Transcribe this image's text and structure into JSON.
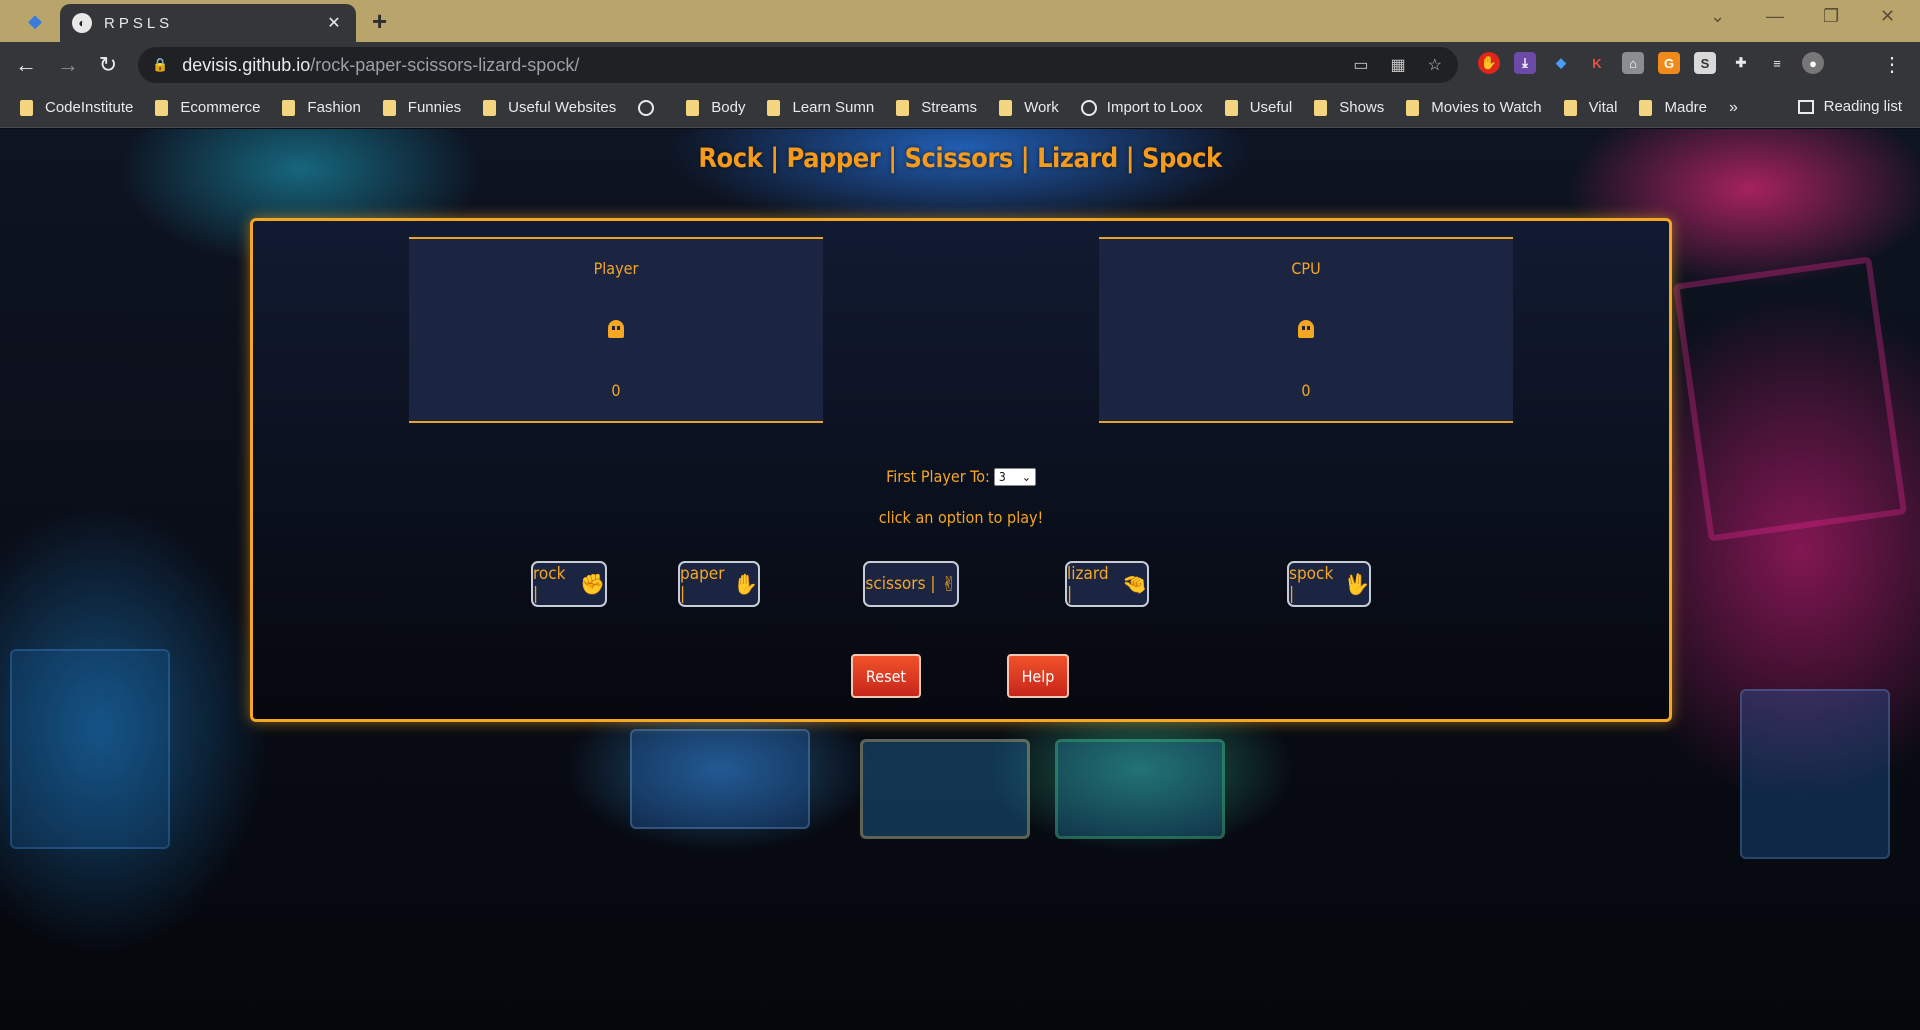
{
  "browser": {
    "tab_title": "RPSLS",
    "url_host": "devisis.github.io",
    "url_path": "/rock-paper-scissors-lizard-spock/",
    "bookmarks": [
      "CodeInstitute",
      "Ecommerce",
      "Fashion",
      "Funnies",
      "Useful Websites",
      "",
      "Body",
      "Learn Sumn",
      "Streams",
      "Work",
      "Import to Loox",
      "Useful",
      "Shows",
      "Movies to Watch",
      "Vital",
      "Madre"
    ],
    "bookmarks_more": "»",
    "reading_list": "Reading list"
  },
  "game": {
    "title": "Rock | Papper | Scissors | Lizard | Spock",
    "player": {
      "label": "Player",
      "score": "0"
    },
    "cpu": {
      "label": "CPU",
      "score": "0"
    },
    "first_to_label": "First Player To:",
    "first_to_value": "3",
    "prompt": "click an option to play!",
    "choices": [
      {
        "label": "rock |",
        "icon": "✊"
      },
      {
        "label": "paper |",
        "icon": "✋"
      },
      {
        "label": "scissors |",
        "icon": "✌"
      },
      {
        "label": "lizard |",
        "icon": "🤏"
      },
      {
        "label": "spock |",
        "icon": "🖖"
      }
    ],
    "reset_label": "Reset",
    "help_label": "Help"
  },
  "colors": {
    "accent": "#f5a623",
    "button_red": "#e23e22",
    "panel": "#1b2542"
  }
}
